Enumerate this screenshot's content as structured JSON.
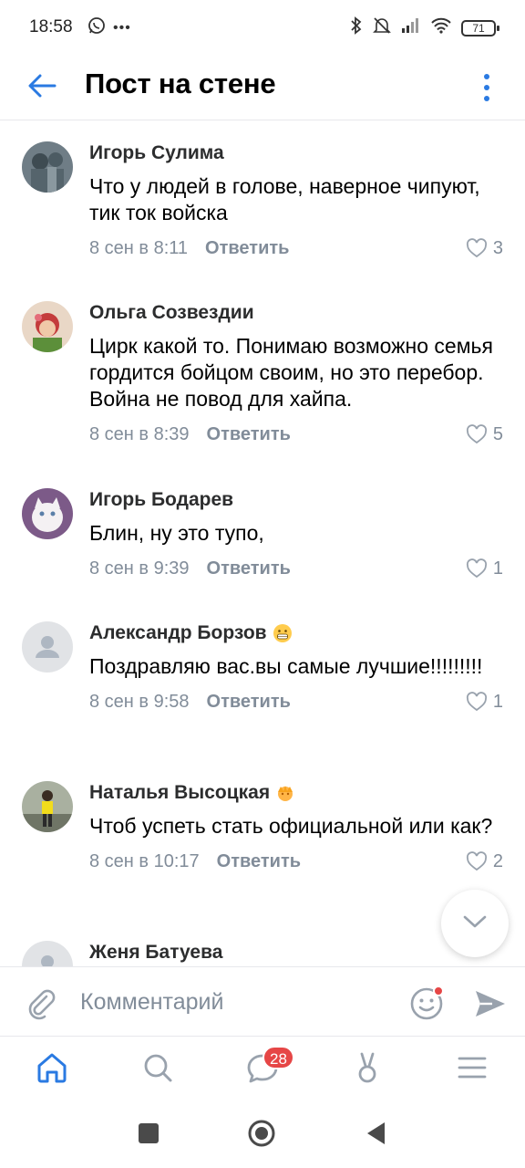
{
  "status_bar": {
    "time": "18:58",
    "battery": "71"
  },
  "header": {
    "title": "Пост на стене"
  },
  "comments": [
    {
      "name": "Игорь Сулима",
      "text": "Что у людей в голове, наверное чипуют, тик ток войска",
      "date": "8 сен в 8:11",
      "reply": "Ответить",
      "likes": "3"
    },
    {
      "name": "Ольга Созвездии",
      "text": "Цирк какой то. Понимаю возможно семья гордится бойцом своим, но это перебор. Война не повод для хайпа.",
      "date": "8 сен в 8:39",
      "reply": "Ответить",
      "likes": "5"
    },
    {
      "name": "Игорь Бодарев",
      "text": "Блин, ну это тупо,",
      "date": "8 сен в 9:39",
      "reply": "Ответить",
      "likes": "1"
    },
    {
      "name": "Александр Борзов",
      "text": "Поздравляю вас.вы самые лучшие!!!!!!!!!",
      "date": "8 сен в 9:58",
      "reply": "Ответить",
      "likes": "1"
    },
    {
      "name": "Наталья Высоцкая",
      "text": "Чтоб успеть стать официальной или как?",
      "date": "8 сен в 10:17",
      "reply": "Ответить",
      "likes": "2"
    },
    {
      "name": "Женя Батуева"
    }
  ],
  "composer": {
    "placeholder": "Комментарий"
  },
  "tabbar": {
    "messages_badge": "28"
  },
  "colors": {
    "accent": "#2a7ae2",
    "secondary_text": "#818c99",
    "badge": "#e64646"
  },
  "icons": [
    "whatsapp-icon",
    "more-icon",
    "bluetooth-icon",
    "mute-icon",
    "signal-icon",
    "wifi-icon",
    "battery-icon",
    "back-arrow-icon",
    "more-vertical-icon",
    "heart-icon",
    "chevron-down-icon",
    "attach-icon",
    "emoji-icon",
    "send-icon",
    "home-icon",
    "search-icon",
    "messages-icon",
    "clips-icon",
    "menu-icon"
  ]
}
